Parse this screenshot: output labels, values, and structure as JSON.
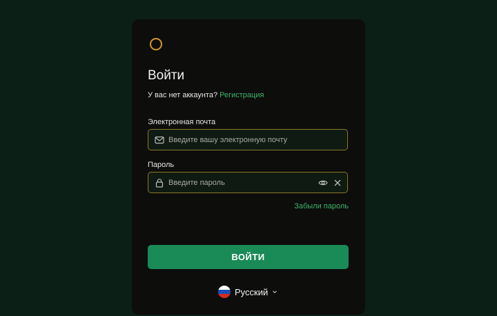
{
  "login": {
    "title": "Войти",
    "no_account_text": "У вас нет аккаунта?",
    "register_link": "Регистрация",
    "email": {
      "label": "Электронная почта",
      "value": "",
      "placeholder": "Введите вашу электронную почту"
    },
    "password": {
      "label": "Пароль",
      "value": "",
      "placeholder": "Введите пароль"
    },
    "forgot_link": "Забыли пароль",
    "submit_label": "ВОЙТИ",
    "language": {
      "selected": "Русский",
      "flag_colors": [
        "#ffffff",
        "#1c4fb5",
        "#d52b1e"
      ]
    }
  },
  "colors": {
    "background": "#0b1f17",
    "card": "#0d0d0c",
    "accent": "#3fb36a",
    "button": "#1a8a57",
    "input_border": "#8a7a2a",
    "logo": "#d9962a"
  },
  "icons": {
    "logo": "ring-logo-icon",
    "email": "mail-icon",
    "password": "lock-icon",
    "show_password": "eye-icon",
    "clear": "close-icon",
    "language_dropdown": "chevron-down-icon"
  }
}
